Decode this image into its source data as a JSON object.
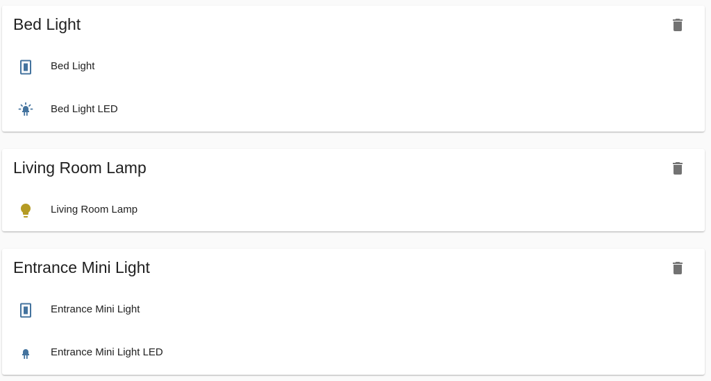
{
  "colors": {
    "icon_blue": "#44739e",
    "icon_on_yellow": "#b59b23",
    "delete_icon": "#727272",
    "card_bg": "#ffffff",
    "page_bg": "#fafafa"
  },
  "devices": [
    {
      "title": "Bed Light",
      "delete_icon": "trash-icon",
      "entities": [
        {
          "label": "Bed Light",
          "icon": "switch-icon",
          "state": "off"
        },
        {
          "label": "Bed Light LED",
          "icon": "led-on-icon",
          "state": "on"
        }
      ]
    },
    {
      "title": "Living Room Lamp",
      "delete_icon": "trash-icon",
      "entities": [
        {
          "label": "Living Room Lamp",
          "icon": "lightbulb-icon",
          "state": "on"
        }
      ]
    },
    {
      "title": "Entrance Mini Light",
      "delete_icon": "trash-icon",
      "entities": [
        {
          "label": "Entrance Mini Light",
          "icon": "switch-icon",
          "state": "off"
        },
        {
          "label": "Entrance Mini Light LED",
          "icon": "led-icon",
          "state": "off"
        }
      ]
    }
  ]
}
